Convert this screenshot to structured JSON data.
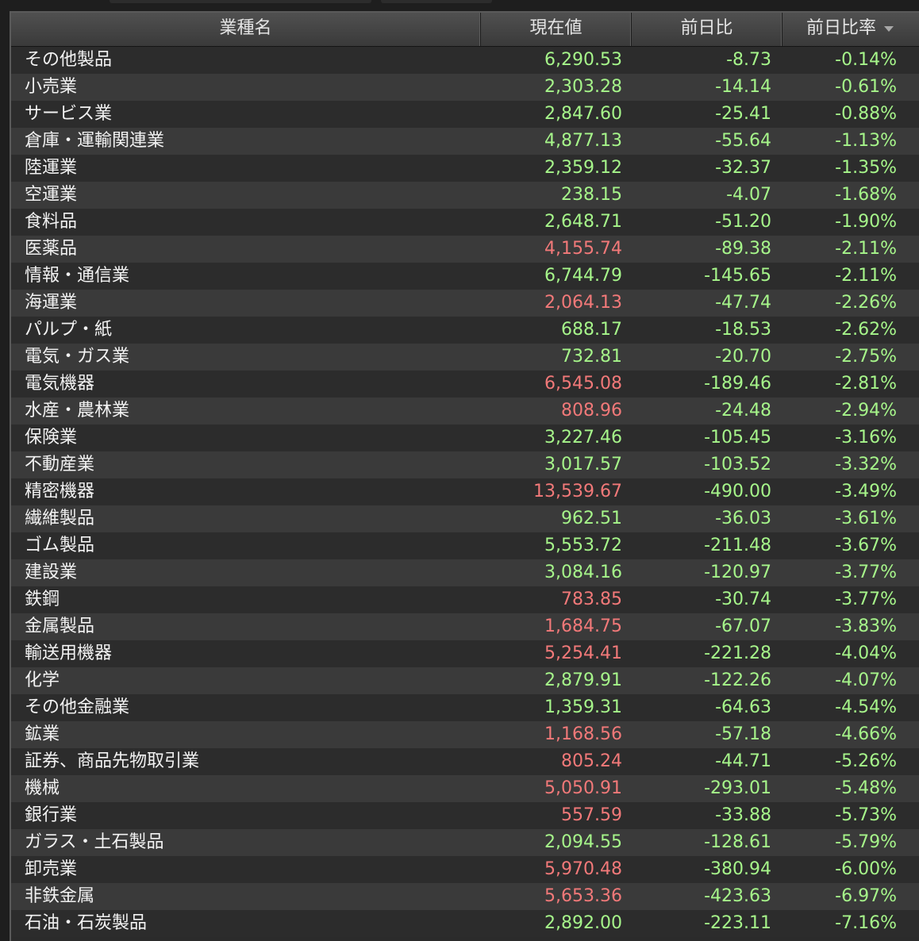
{
  "table": {
    "headers": {
      "name": "業種名",
      "price": "現在値",
      "change": "前日比",
      "change_pct": "前日比率"
    },
    "sort_icon": "sort-descending-icon",
    "colors": {
      "up": "#a6f58a",
      "down": "#f27979",
      "text": "#f2f2f2"
    },
    "rows": [
      {
        "name": "その他製品",
        "price": "6,290.53",
        "price_color": "green",
        "change": "-8.73",
        "change_pct": "-0.14%"
      },
      {
        "name": "小売業",
        "price": "2,303.28",
        "price_color": "green",
        "change": "-14.14",
        "change_pct": "-0.61%"
      },
      {
        "name": "サービス業",
        "price": "2,847.60",
        "price_color": "green",
        "change": "-25.41",
        "change_pct": "-0.88%"
      },
      {
        "name": "倉庫・運輸関連業",
        "price": "4,877.13",
        "price_color": "green",
        "change": "-55.64",
        "change_pct": "-1.13%"
      },
      {
        "name": "陸運業",
        "price": "2,359.12",
        "price_color": "green",
        "change": "-32.37",
        "change_pct": "-1.35%"
      },
      {
        "name": "空運業",
        "price": "238.15",
        "price_color": "green",
        "change": "-4.07",
        "change_pct": "-1.68%"
      },
      {
        "name": "食料品",
        "price": "2,648.71",
        "price_color": "green",
        "change": "-51.20",
        "change_pct": "-1.90%"
      },
      {
        "name": "医薬品",
        "price": "4,155.74",
        "price_color": "red",
        "change": "-89.38",
        "change_pct": "-2.11%"
      },
      {
        "name": "情報・通信業",
        "price": "6,744.79",
        "price_color": "green",
        "change": "-145.65",
        "change_pct": "-2.11%"
      },
      {
        "name": "海運業",
        "price": "2,064.13",
        "price_color": "red",
        "change": "-47.74",
        "change_pct": "-2.26%"
      },
      {
        "name": "パルプ・紙",
        "price": "688.17",
        "price_color": "green",
        "change": "-18.53",
        "change_pct": "-2.62%"
      },
      {
        "name": "電気・ガス業",
        "price": "732.81",
        "price_color": "green",
        "change": "-20.70",
        "change_pct": "-2.75%"
      },
      {
        "name": "電気機器",
        "price": "6,545.08",
        "price_color": "red",
        "change": "-189.46",
        "change_pct": "-2.81%"
      },
      {
        "name": "水産・農林業",
        "price": "808.96",
        "price_color": "red",
        "change": "-24.48",
        "change_pct": "-2.94%"
      },
      {
        "name": "保険業",
        "price": "3,227.46",
        "price_color": "green",
        "change": "-105.45",
        "change_pct": "-3.16%"
      },
      {
        "name": "不動産業",
        "price": "3,017.57",
        "price_color": "green",
        "change": "-103.52",
        "change_pct": "-3.32%"
      },
      {
        "name": "精密機器",
        "price": "13,539.67",
        "price_color": "red",
        "change": "-490.00",
        "change_pct": "-3.49%"
      },
      {
        "name": "繊維製品",
        "price": "962.51",
        "price_color": "green",
        "change": "-36.03",
        "change_pct": "-3.61%"
      },
      {
        "name": "ゴム製品",
        "price": "5,553.72",
        "price_color": "green",
        "change": "-211.48",
        "change_pct": "-3.67%"
      },
      {
        "name": "建設業",
        "price": "3,084.16",
        "price_color": "green",
        "change": "-120.97",
        "change_pct": "-3.77%"
      },
      {
        "name": "鉄鋼",
        "price": "783.85",
        "price_color": "red",
        "change": "-30.74",
        "change_pct": "-3.77%"
      },
      {
        "name": "金属製品",
        "price": "1,684.75",
        "price_color": "red",
        "change": "-67.07",
        "change_pct": "-3.83%"
      },
      {
        "name": "輸送用機器",
        "price": "5,254.41",
        "price_color": "red",
        "change": "-221.28",
        "change_pct": "-4.04%"
      },
      {
        "name": "化学",
        "price": "2,879.91",
        "price_color": "green",
        "change": "-122.26",
        "change_pct": "-4.07%"
      },
      {
        "name": "その他金融業",
        "price": "1,359.31",
        "price_color": "green",
        "change": "-64.63",
        "change_pct": "-4.54%"
      },
      {
        "name": "鉱業",
        "price": "1,168.56",
        "price_color": "red",
        "change": "-57.18",
        "change_pct": "-4.66%"
      },
      {
        "name": "証券、商品先物取引業",
        "price": "805.24",
        "price_color": "red",
        "change": "-44.71",
        "change_pct": "-5.26%"
      },
      {
        "name": "機械",
        "price": "5,050.91",
        "price_color": "red",
        "change": "-293.01",
        "change_pct": "-5.48%"
      },
      {
        "name": "銀行業",
        "price": "557.59",
        "price_color": "red",
        "change": "-33.88",
        "change_pct": "-5.73%"
      },
      {
        "name": "ガラス・土石製品",
        "price": "2,094.55",
        "price_color": "green",
        "change": "-128.61",
        "change_pct": "-5.79%"
      },
      {
        "name": "卸売業",
        "price": "5,970.48",
        "price_color": "red",
        "change": "-380.94",
        "change_pct": "-6.00%"
      },
      {
        "name": "非鉄金属",
        "price": "5,653.36",
        "price_color": "red",
        "change": "-423.63",
        "change_pct": "-6.97%"
      },
      {
        "name": "石油・石炭製品",
        "price": "2,892.00",
        "price_color": "green",
        "change": "-223.11",
        "change_pct": "-7.16%"
      }
    ]
  }
}
